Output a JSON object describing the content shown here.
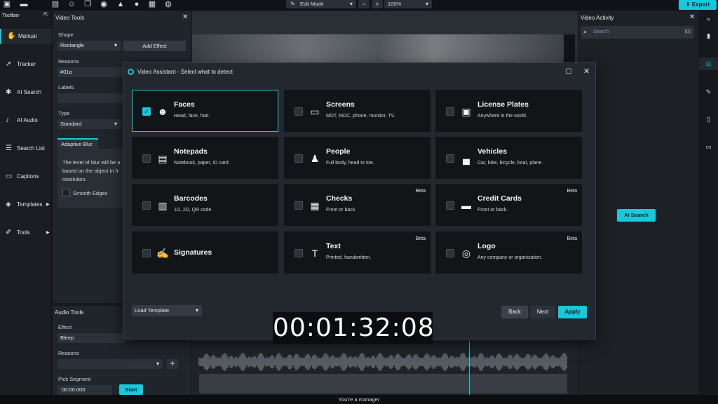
{
  "topbar": {
    "mode": "Edit Mode",
    "zoom": "100%",
    "export_label": "Export",
    "icons": [
      "new-file-icon",
      "open-folder-icon",
      "save-icon",
      "person-icon",
      "copy-icon",
      "record-icon",
      "warning-icon",
      "info-icon",
      "calendar-icon",
      "chat-icon"
    ]
  },
  "toolbar": {
    "title": "Toolbar",
    "items": [
      {
        "label": "Manual",
        "icon": "hand-icon"
      },
      {
        "label": "Tracker",
        "icon": "run-icon"
      },
      {
        "label": "AI Search",
        "icon": "sparkle-icon"
      },
      {
        "label": "AI Audio",
        "icon": "mic-icon"
      },
      {
        "label": "Search List",
        "icon": "list-icon"
      },
      {
        "label": "Captions",
        "icon": "captions-icon"
      },
      {
        "label": "Templates",
        "icon": "layers-icon"
      },
      {
        "label": "Tools",
        "icon": "wrench-icon"
      }
    ]
  },
  "video_tools": {
    "title": "Video Tools",
    "shape_label": "Shape",
    "shape_value": "Rectangle",
    "add_effect": "Add Effect",
    "reasons_label": "Reasons",
    "reasons_value": "#01a",
    "labels_label": "Labels",
    "type_label": "Type",
    "type_value": "Standard",
    "tab_label": "Adaptive Blur",
    "desc_1": "The level of blur will be a",
    "desc_2": "based on the object in fr",
    "desc_3": "resolution.",
    "smooth_edges": "Smooth Edges"
  },
  "audio_tools": {
    "title": "Audio Tools",
    "effect_label": "Effect",
    "effect_value": "Bleep",
    "reasons_label": "Reasons",
    "pick_segment_label": "Pick Segment",
    "time_value": "00:00.000",
    "start_label": "Start"
  },
  "activity": {
    "title": "Video Activity",
    "search_placeholder": "Search",
    "count": "(0)",
    "ai_search": "AI Search"
  },
  "modal": {
    "title": "Video Assistant - Select what to detect",
    "cards": [
      {
        "title": "Faces",
        "subtitle": "Head, face, hair.",
        "icon": "face-icon",
        "checked": true,
        "beta": ""
      },
      {
        "title": "Screens",
        "subtitle": "MDT, MDC, phone, monitor, TV.",
        "icon": "monitor-icon",
        "checked": false,
        "beta": ""
      },
      {
        "title": "License Plates",
        "subtitle": "Anywhere in the world.",
        "icon": "license-plate-icon",
        "checked": false,
        "beta": ""
      },
      {
        "title": "Notepads",
        "subtitle": "Notebook, paper, ID card.",
        "icon": "notepad-icon",
        "checked": false,
        "beta": ""
      },
      {
        "title": "People",
        "subtitle": "Full body, head to toe.",
        "icon": "people-icon",
        "checked": false,
        "beta": ""
      },
      {
        "title": "Vehicles",
        "subtitle": "Car, bike, bicycle, boat, plane.",
        "icon": "car-icon",
        "checked": false,
        "beta": ""
      },
      {
        "title": "Barcodes",
        "subtitle": "1D, 2D, QR code.",
        "icon": "barcode-icon",
        "checked": false,
        "beta": ""
      },
      {
        "title": "Checks",
        "subtitle": "Front or back.",
        "icon": "check-document-icon",
        "checked": false,
        "beta": "Beta"
      },
      {
        "title": "Credit Cards",
        "subtitle": "Front or back.",
        "icon": "credit-card-icon",
        "checked": false,
        "beta": "Beta"
      },
      {
        "title": "Signatures",
        "subtitle": "",
        "icon": "signature-icon",
        "checked": false,
        "beta": ""
      },
      {
        "title": "Text",
        "subtitle": "Printed, handwritten.",
        "icon": "text-icon",
        "checked": false,
        "beta": "Beta"
      },
      {
        "title": "Logo",
        "subtitle": "Any company or organization.",
        "icon": "logo-icon",
        "checked": false,
        "beta": "Beta"
      }
    ],
    "load_template": "Load Template",
    "back": "Back",
    "next": "Next",
    "apply": "Apply"
  },
  "timecode": "00:01:32:08",
  "status": "You're a manager",
  "colors": {
    "accent": "#17c9dc",
    "background": "#16191e",
    "card": "#121518"
  }
}
